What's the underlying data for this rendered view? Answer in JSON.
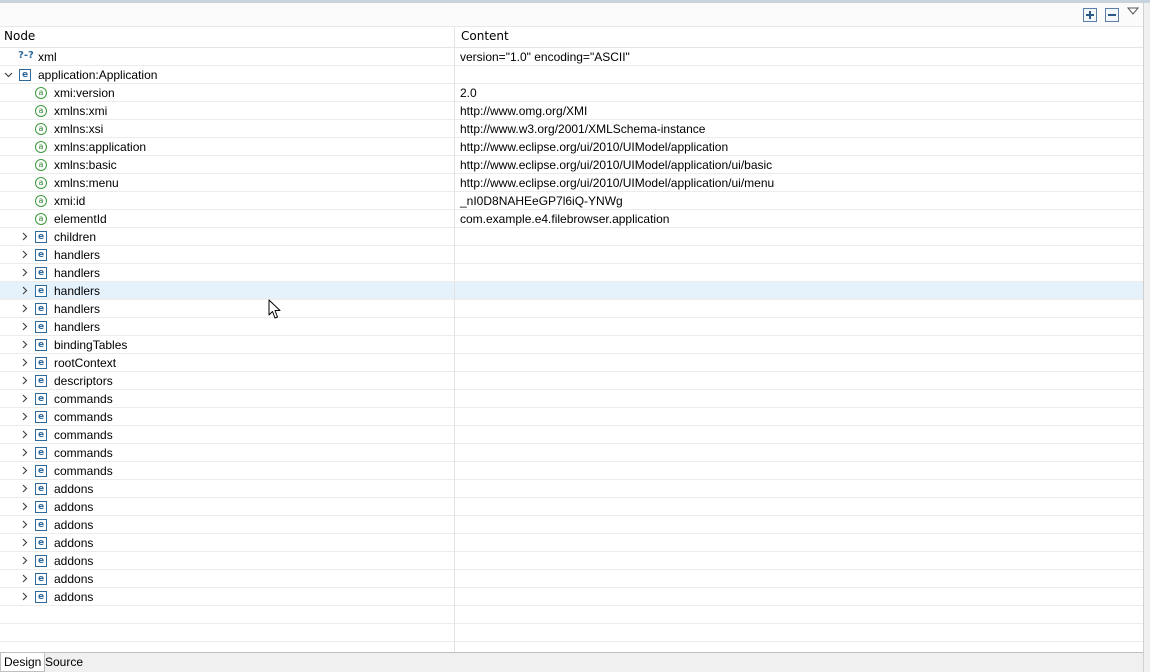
{
  "columns": {
    "node": "Node",
    "content": "Content"
  },
  "tabs": {
    "design": "Design",
    "source": "Source"
  },
  "rows": [
    {
      "label": "xml",
      "value": "version=\"1.0\" encoding=\"ASCII\"",
      "icon": "processing-instruction-icon",
      "glyph": "?-?"
    },
    {
      "label": "application:Application",
      "value": "",
      "icon": "element-icon",
      "glyph": "e"
    },
    {
      "label": "xmi:version",
      "value": "2.0",
      "icon": "attribute-icon",
      "glyph": "a"
    },
    {
      "label": "xmlns:xmi",
      "value": "http://www.omg.org/XMI",
      "icon": "attribute-icon",
      "glyph": "a"
    },
    {
      "label": "xmlns:xsi",
      "value": "http://www.w3.org/2001/XMLSchema-instance",
      "icon": "attribute-icon",
      "glyph": "a"
    },
    {
      "label": "xmlns:application",
      "value": "http://www.eclipse.org/ui/2010/UIModel/application",
      "icon": "attribute-icon",
      "glyph": "a"
    },
    {
      "label": "xmlns:basic",
      "value": "http://www.eclipse.org/ui/2010/UIModel/application/ui/basic",
      "icon": "attribute-icon",
      "glyph": "a"
    },
    {
      "label": "xmlns:menu",
      "value": "http://www.eclipse.org/ui/2010/UIModel/application/ui/menu",
      "icon": "attribute-icon",
      "glyph": "a"
    },
    {
      "label": "xmi:id",
      "value": "_nI0D8NAHEeGP7l6iQ-YNWg",
      "icon": "attribute-icon",
      "glyph": "a"
    },
    {
      "label": "elementId",
      "value": "com.example.e4.filebrowser.application",
      "icon": "attribute-icon",
      "glyph": "a"
    },
    {
      "label": "children",
      "value": "",
      "icon": "element-icon",
      "glyph": "e"
    },
    {
      "label": "handlers",
      "value": "",
      "icon": "element-icon",
      "glyph": "e"
    },
    {
      "label": "handlers",
      "value": "",
      "icon": "element-icon",
      "glyph": "e"
    },
    {
      "label": "handlers",
      "value": "",
      "icon": "element-icon",
      "glyph": "e"
    },
    {
      "label": "handlers",
      "value": "",
      "icon": "element-icon",
      "glyph": "e"
    },
    {
      "label": "handlers",
      "value": "",
      "icon": "element-icon",
      "glyph": "e"
    },
    {
      "label": "bindingTables",
      "value": "",
      "icon": "element-icon",
      "glyph": "e"
    },
    {
      "label": "rootContext",
      "value": "",
      "icon": "element-icon",
      "glyph": "e"
    },
    {
      "label": "descriptors",
      "value": "",
      "icon": "element-icon",
      "glyph": "e"
    },
    {
      "label": "commands",
      "value": "",
      "icon": "element-icon",
      "glyph": "e"
    },
    {
      "label": "commands",
      "value": "",
      "icon": "element-icon",
      "glyph": "e"
    },
    {
      "label": "commands",
      "value": "",
      "icon": "element-icon",
      "glyph": "e"
    },
    {
      "label": "commands",
      "value": "",
      "icon": "element-icon",
      "glyph": "e"
    },
    {
      "label": "commands",
      "value": "",
      "icon": "element-icon",
      "glyph": "e"
    },
    {
      "label": "addons",
      "value": "",
      "icon": "element-icon",
      "glyph": "e"
    },
    {
      "label": "addons",
      "value": "",
      "icon": "element-icon",
      "glyph": "e"
    },
    {
      "label": "addons",
      "value": "",
      "icon": "element-icon",
      "glyph": "e"
    },
    {
      "label": "addons",
      "value": "",
      "icon": "element-icon",
      "glyph": "e"
    },
    {
      "label": "addons",
      "value": "",
      "icon": "element-icon",
      "glyph": "e"
    },
    {
      "label": "addons",
      "value": "",
      "icon": "element-icon",
      "glyph": "e"
    },
    {
      "label": "addons",
      "value": "",
      "icon": "element-icon",
      "glyph": "e"
    }
  ],
  "colors": {
    "selection": "#e5f1fb",
    "element_icon": "#2e6a9c",
    "attribute_icon": "#3c9a3c"
  }
}
